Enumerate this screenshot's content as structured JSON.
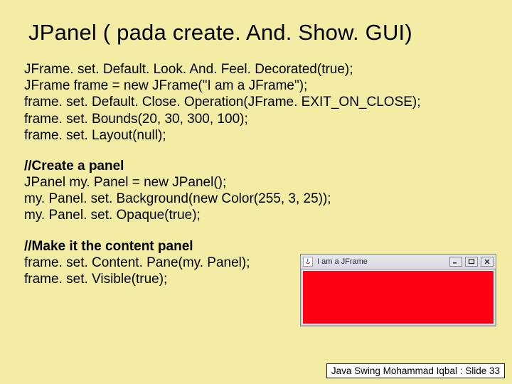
{
  "title": "JPanel ( pada create. And. Show. GUI)",
  "code": {
    "b1l1": "JFrame. set. Default. Look. And. Feel. Decorated(true);",
    "b1l2": "JFrame frame = new JFrame(\"I am a JFrame\");",
    "b1l3": "frame. set. Default. Close. Operation(JFrame. EXIT_ON_CLOSE);",
    "b1l4": "frame. set. Bounds(20, 30, 300, 100);",
    "b1l5": "frame. set. Layout(null);",
    "b2h": "//Create a panel",
    "b2l1": "JPanel my. Panel = new JPanel();",
    "b2l2": "my. Panel. set. Background(new Color(255, 3, 25));",
    "b2l3": "my. Panel. set. Opaque(true);",
    "b3h": "//Make it the content panel",
    "b3l1": "frame. set. Content. Pane(my. Panel);",
    "b3l2": "frame. set. Visible(true);"
  },
  "jframe": {
    "title": "I am a JFrame",
    "content_color": "#ff0319"
  },
  "footer": "Java Swing Mohammad Iqbal : Slide 33"
}
